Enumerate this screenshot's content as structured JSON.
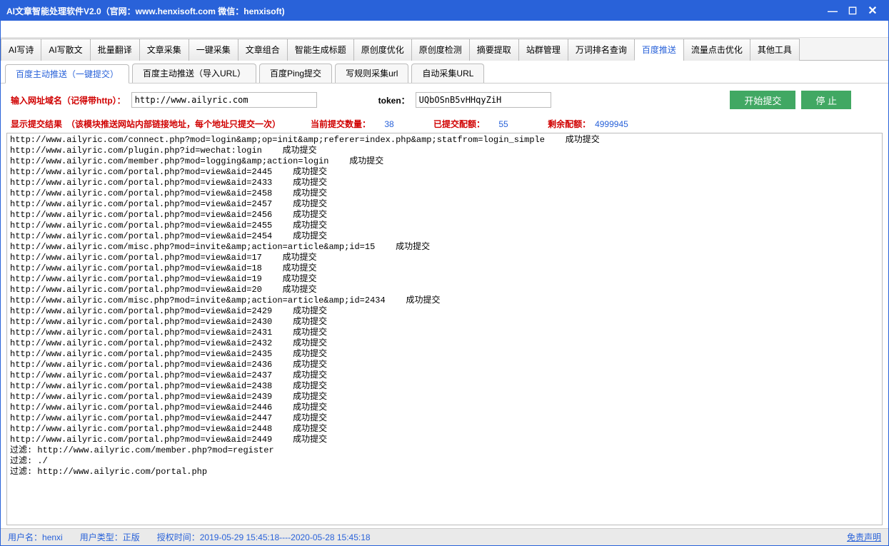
{
  "title": "AI文章智能处理软件V2.0（官网：www.henxisoft.com 微信：henxisoft)",
  "mainTabs": [
    "AI写诗",
    "AI写散文",
    "批量翻译",
    "文章采集",
    "一键采集",
    "文章组合",
    "智能生成标题",
    "原创度优化",
    "原创度检测",
    "摘要提取",
    "站群管理",
    "万词排名查询",
    "百度推送",
    "流量点击优化",
    "其他工具"
  ],
  "mainActive": 12,
  "subTabs": [
    "百度主动推送（一键提交）",
    "百度主动推送（导入URL）",
    "百度Ping提交",
    "写规则采集url",
    "自动采集URL"
  ],
  "subActive": 0,
  "form": {
    "domainLabel": "输入网址域名（记得带http）：",
    "domainValue": "http://www.ailyric.com",
    "tokenLabel": "token：",
    "tokenValue": "UQbOSnB5vHHqyZiH",
    "startBtn": "开始提交",
    "stopBtn": "停 止"
  },
  "status": {
    "resultLabel": "显示提交结果",
    "resultNote": "（该模块推送网站内部链接地址，每个地址只提交一次）",
    "currentLabel": "当前提交数量：",
    "currentValue": "38",
    "submittedLabel": "已提交配额：",
    "submittedValue": "55",
    "remainLabel": "剩余配额：",
    "remainValue": "4999945"
  },
  "logLines": [
    "http://www.ailyric.com/connect.php?mod=login&amp;op=init&amp;referer=index.php&amp;statfrom=login_simple    成功提交",
    "http://www.ailyric.com/plugin.php?id=wechat:login    成功提交",
    "http://www.ailyric.com/member.php?mod=logging&amp;action=login    成功提交",
    "http://www.ailyric.com/portal.php?mod=view&aid=2445    成功提交",
    "http://www.ailyric.com/portal.php?mod=view&aid=2433    成功提交",
    "http://www.ailyric.com/portal.php?mod=view&aid=2458    成功提交",
    "http://www.ailyric.com/portal.php?mod=view&aid=2457    成功提交",
    "http://www.ailyric.com/portal.php?mod=view&aid=2456    成功提交",
    "http://www.ailyric.com/portal.php?mod=view&aid=2455    成功提交",
    "http://www.ailyric.com/portal.php?mod=view&aid=2454    成功提交",
    "http://www.ailyric.com/misc.php?mod=invite&amp;action=article&amp;id=15    成功提交",
    "http://www.ailyric.com/portal.php?mod=view&aid=17    成功提交",
    "http://www.ailyric.com/portal.php?mod=view&aid=18    成功提交",
    "http://www.ailyric.com/portal.php?mod=view&aid=19    成功提交",
    "http://www.ailyric.com/portal.php?mod=view&aid=20    成功提交",
    "http://www.ailyric.com/misc.php?mod=invite&amp;action=article&amp;id=2434    成功提交",
    "http://www.ailyric.com/portal.php?mod=view&aid=2429    成功提交",
    "http://www.ailyric.com/portal.php?mod=view&aid=2430    成功提交",
    "http://www.ailyric.com/portal.php?mod=view&aid=2431    成功提交",
    "http://www.ailyric.com/portal.php?mod=view&aid=2432    成功提交",
    "http://www.ailyric.com/portal.php?mod=view&aid=2435    成功提交",
    "http://www.ailyric.com/portal.php?mod=view&aid=2436    成功提交",
    "http://www.ailyric.com/portal.php?mod=view&aid=2437    成功提交",
    "http://www.ailyric.com/portal.php?mod=view&aid=2438    成功提交",
    "http://www.ailyric.com/portal.php?mod=view&aid=2439    成功提交",
    "http://www.ailyric.com/portal.php?mod=view&aid=2446    成功提交",
    "http://www.ailyric.com/portal.php?mod=view&aid=2447    成功提交",
    "http://www.ailyric.com/portal.php?mod=view&aid=2448    成功提交",
    "http://www.ailyric.com/portal.php?mod=view&aid=2449    成功提交",
    "",
    "过滤: http://www.ailyric.com/member.php?mod=register",
    "过滤: ./",
    "过滤: http://www.ailyric.com/portal.php"
  ],
  "footer": {
    "userLabel": "用户名：",
    "userValue": "henxi",
    "typeLabel": "用户类型：",
    "typeValue": "正版",
    "authLabel": "授权时间：",
    "authValue": "2019-05-29 15:45:18----2020-05-28 15:45:18",
    "disclaimer": "免责声明"
  }
}
